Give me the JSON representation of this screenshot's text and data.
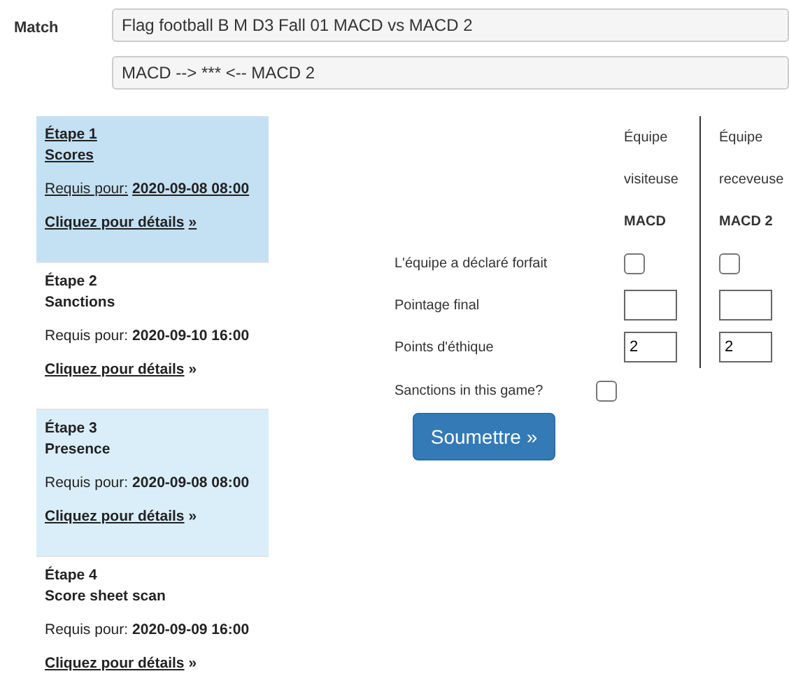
{
  "match": {
    "label": "Match",
    "title": "Flag football B M D3 Fall 01 MACD vs MACD 2",
    "summary": "MACD --> *** <-- MACD 2"
  },
  "steps": [
    {
      "step": "Étape 1",
      "name": "Scores",
      "due_label": "Requis pour:",
      "due": "2020-09-08 08:00",
      "link": "Cliquez pour détails",
      "arrow": "»",
      "selected": true
    },
    {
      "step": "Étape 2",
      "name": "Sanctions",
      "due_label": "Requis pour:",
      "due": "2020-09-10 16:00",
      "link": "Cliquez pour détails",
      "arrow": "»",
      "selected": false
    },
    {
      "step": "Étape 3",
      "name": "Presence",
      "due_label": "Requis pour:",
      "due": "2020-09-08 08:00",
      "link": "Cliquez pour détails",
      "arrow": "»",
      "selected": false
    },
    {
      "step": "Étape 4",
      "name": "Score sheet scan",
      "due_label": "Requis pour:",
      "due": "2020-09-09 16:00",
      "link": "Cliquez pour détails",
      "arrow": "»",
      "selected": false
    }
  ],
  "form": {
    "teams": [
      {
        "line1": "Équipe",
        "line2": "visiteuse",
        "name": "MACD"
      },
      {
        "line1": "Équipe",
        "line2": "receveuse",
        "name": "MACD 2"
      }
    ],
    "rows": [
      {
        "kind": "checkbox",
        "label": "L'équipe a déclaré forfait",
        "cells": [
          {
            "checked": false
          },
          {
            "checked": false
          }
        ]
      },
      {
        "kind": "text",
        "label": "Pointage final",
        "cells": [
          {},
          {}
        ]
      },
      {
        "kind": "text",
        "label": "Points d'éthique",
        "cells": [
          {
            "value": "2"
          },
          {
            "value": "2"
          }
        ]
      }
    ],
    "sanctions": {
      "label": "Sanctions in this game?",
      "checked": false
    },
    "submit": "Soumettre »"
  }
}
